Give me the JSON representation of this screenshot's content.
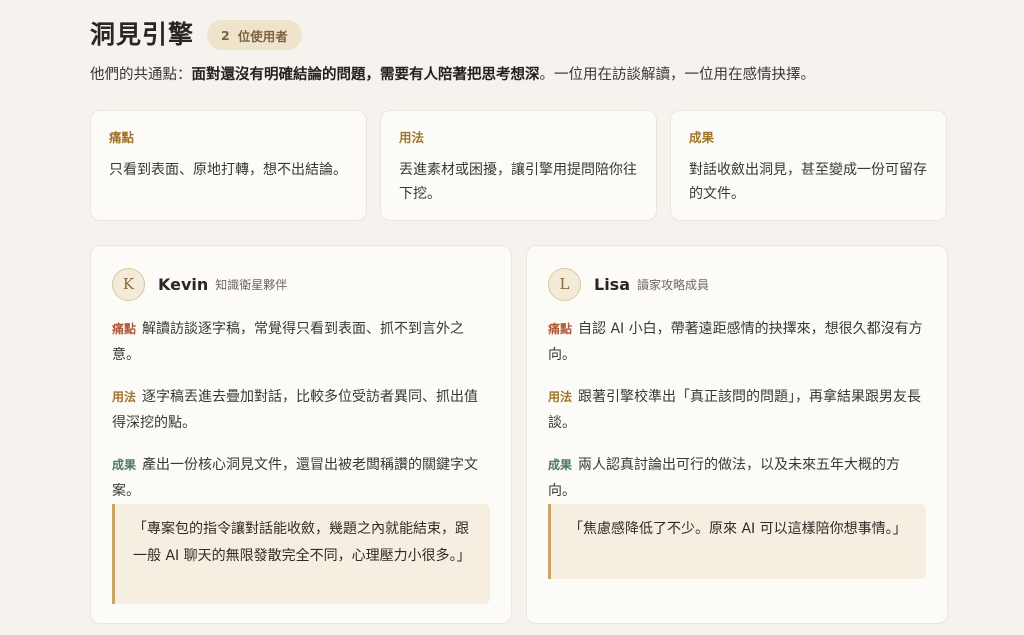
{
  "header": {
    "title": "洞見引擎",
    "badge_count": "2",
    "badge_label": "位使用者",
    "subtitle_lead": "他們的共通點：",
    "subtitle_bold": "面對還沒有明確結論的問題，需要有人陪著把思考想深",
    "subtitle_tail": "。一位用在訪談解讀，一位用在感情抉擇。"
  },
  "features": [
    {
      "label": "痛點",
      "text": "只看到表面、原地打轉，想不出結論。"
    },
    {
      "label": "用法",
      "text": "丟進素材或困擾，讓引擎用提問陪你往下挖。"
    },
    {
      "label": "成果",
      "text": "對話收斂出洞見，甚至變成一份可留存的文件。"
    }
  ],
  "users": [
    {
      "initial": "K",
      "name": "Kevin",
      "role": "知識衛星夥伴",
      "pain_tag": "痛點",
      "pain": "解讀訪談逐字稿，常覺得只看到表面、抓不到言外之意。",
      "use_tag": "用法",
      "use": "逐字稿丟進去疊加對話，比較多位受訪者異同、抓出值得深挖的點。",
      "result_tag": "成果",
      "result": "產出一份核心洞見文件，還冒出被老闆稱讚的關鍵字文案。",
      "quote": "「專案包的指令讓對話能收斂，幾題之內就能結束，跟一般 AI 聊天的無限發散完全不同，心理壓力小很多。」"
    },
    {
      "initial": "L",
      "name": "Lisa",
      "role": "讀家攻略成員",
      "pain_tag": "痛點",
      "pain": "自認 AI 小白，帶著遠距感情的抉擇來，想很久都沒有方向。",
      "use_tag": "用法",
      "use": "跟著引擎校準出「真正該問的問題」，再拿結果跟男友長談。",
      "result_tag": "成果",
      "result": "兩人認真討論出可行的做法，以及未來五年大概的方向。",
      "quote": "「焦慮感降低了不少。原來 AI 可以這樣陪你想事情。」"
    }
  ]
}
